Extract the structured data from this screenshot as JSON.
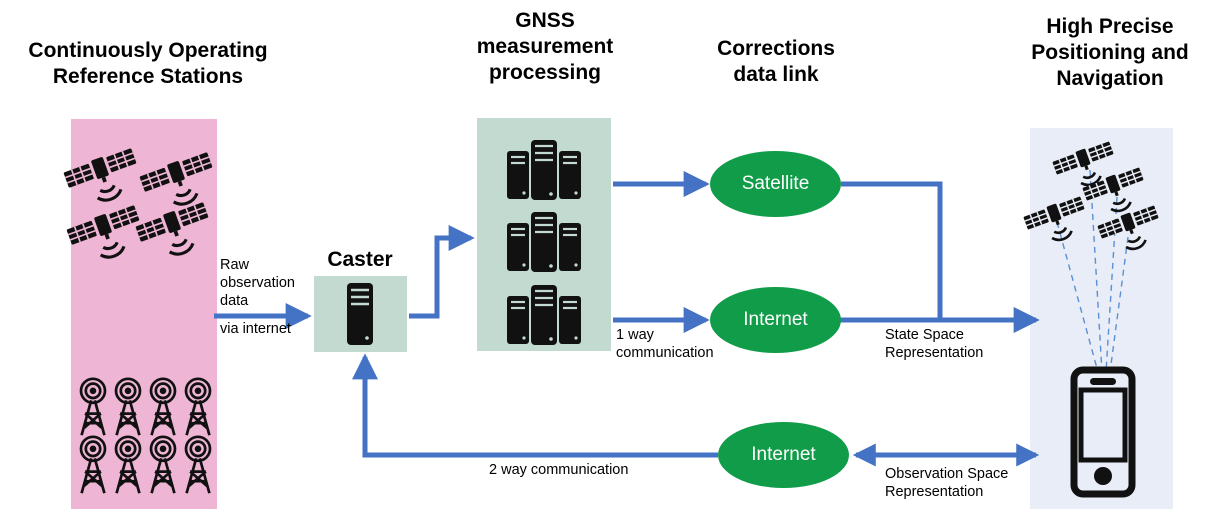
{
  "diagram": {
    "title": "GNSS high precision positioning architecture",
    "colors": {
      "reference_panel": "#EEB5D5",
      "process_panel": "#C2DAD0",
      "user_panel": "#E8EDF7",
      "ellipse_green": "#109C48",
      "arrow_blue": "#4472C4",
      "signal_blue": "#5B8FD4",
      "icon_black": "#111111"
    },
    "headers": [
      {
        "id": "crs",
        "text": "Continuously  Operating\nReference Stations"
      },
      {
        "id": "gnss",
        "text": "GNSS\nmeasurement\nprocessing"
      },
      {
        "id": "corr",
        "text": "Corrections\ndata link"
      },
      {
        "id": "user",
        "text": "High Precise\nPositioning and\nNavigation"
      }
    ],
    "nodes": {
      "caster": {
        "label": "Caster",
        "icon": "server-tower-icon"
      },
      "reference_stations": {
        "satellite_icon": "satellite-icon",
        "satellite_count": 4,
        "antenna_icon": "antenna-tower-icon",
        "antenna_count": 8
      },
      "gnss_processing": {
        "icon": "server-cluster-icon",
        "cluster_count": 3
      },
      "user_segment": {
        "satellite_icon": "satellite-icon",
        "satellite_count": 4,
        "receiver_icon": "smartphone-icon"
      }
    },
    "ellipses": [
      {
        "id": "satellite-link",
        "label": "Satellite"
      },
      {
        "id": "internet-link-1way",
        "label": "Internet"
      },
      {
        "id": "internet-link-2way",
        "label": "Internet"
      }
    ],
    "edge_labels": [
      {
        "id": "raw-obs",
        "text": "Raw\nobservation\ndata"
      },
      {
        "id": "via-net",
        "text": "via internet"
      },
      {
        "id": "one-way",
        "text": "1 way\ncommunication"
      },
      {
        "id": "ssr",
        "text": "State Space\nRepresentation"
      },
      {
        "id": "two-way",
        "text": "2 way communication"
      },
      {
        "id": "osr",
        "text": "Observation Space\nRepresentation"
      }
    ]
  }
}
